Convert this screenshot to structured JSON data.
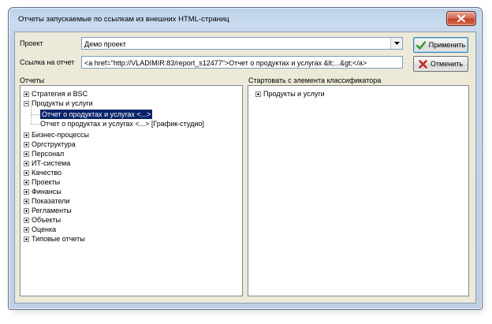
{
  "window": {
    "title": "Отчеты запускаемые по ссылкам из внешних HTML-страниц"
  },
  "form": {
    "project_label": "Проект",
    "project_value": "Демо проект",
    "link_label": "Ссылка на отчет",
    "link_value": "<a href=\"http://VLADIMIR:83/report_s12477\">Отчет о продуктах и услугах &lt;...&gt;</a>"
  },
  "buttons": {
    "apply": "Применить",
    "cancel": "Отменить"
  },
  "reports_panel": {
    "label": "Отчеты",
    "items": [
      {
        "label": "Стратегия и BSC"
      },
      {
        "label": "Продукты и услуги"
      },
      {
        "label": "Отчет о продуктах и услугах <...>"
      },
      {
        "label": "Отчет о продуктах и услугах <...> [График-студио]"
      },
      {
        "label": "Бизнес-процессы"
      },
      {
        "label": "Оргструктура"
      },
      {
        "label": "Персонал"
      },
      {
        "label": "ИТ-система"
      },
      {
        "label": "Качество"
      },
      {
        "label": "Проекты"
      },
      {
        "label": "Финансы"
      },
      {
        "label": "Показатели"
      },
      {
        "label": "Регламенты"
      },
      {
        "label": "Объекты"
      },
      {
        "label": "Оценка"
      },
      {
        "label": "Типовые отчеты"
      }
    ]
  },
  "classifier_panel": {
    "label": "Стартовать с элемента классификатора",
    "items": [
      {
        "label": "Продукты и услуги"
      }
    ]
  },
  "colors": {
    "selection": "#0a246a",
    "apply_icon": "#2e9a2e",
    "cancel_icon": "#c0281e"
  }
}
